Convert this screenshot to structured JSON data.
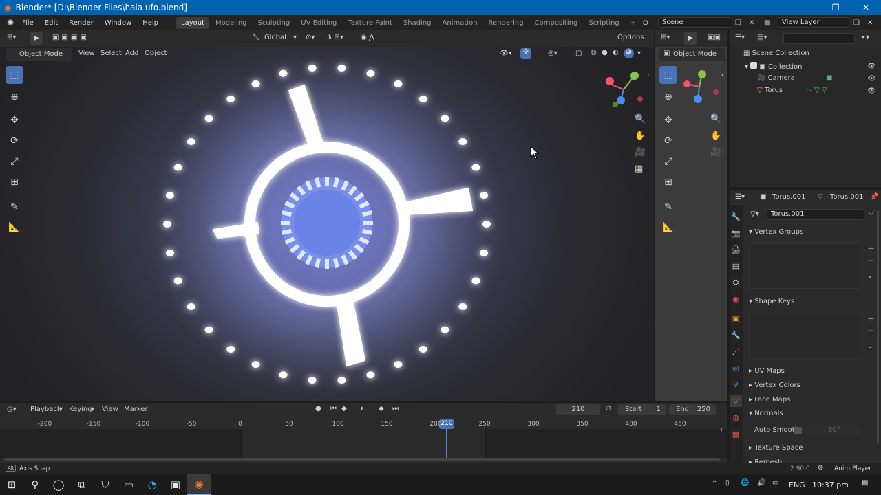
{
  "window": {
    "title": "Blender* [D:\\Blender Files\\hala ufo.blend]",
    "minimize": "—",
    "maximize": "❐",
    "close": "✕"
  },
  "menus": [
    "File",
    "Edit",
    "Render",
    "Window",
    "Help"
  ],
  "workspaces": [
    "Layout",
    "Modeling",
    "Sculpting",
    "UV Editing",
    "Texture Paint",
    "Shading",
    "Animation",
    "Rendering",
    "Compositing",
    "Scripting"
  ],
  "add_workspace": "+",
  "scene": {
    "name": "Scene",
    "view_layer": "View Layer"
  },
  "viewport": {
    "mode": "Object Mode",
    "menus": [
      "View",
      "Select",
      "Add",
      "Object"
    ],
    "orientation": "Global",
    "options": "Options"
  },
  "secondary_viewport": {
    "mode": "Object Mode"
  },
  "outliner": {
    "search_placeholder": "",
    "items": [
      {
        "label": "Scene Collection"
      },
      {
        "label": "Collection"
      },
      {
        "label": "Camera"
      },
      {
        "label": "Torus"
      }
    ]
  },
  "properties": {
    "object_name": "Torus.001",
    "mesh_name": "Torus.001",
    "data_field": "Torus.001",
    "sections": {
      "vertex_groups": "Vertex Groups",
      "shape_keys": "Shape Keys",
      "uv_maps": "UV Maps",
      "vertex_colors": "Vertex Colors",
      "face_maps": "Face Maps",
      "normals": "Normals",
      "auto_smooth": "Auto Smooth",
      "auto_smooth_angle": "30°",
      "texture_space": "Texture Space",
      "remesh": "Remesh"
    }
  },
  "timeline": {
    "menus": [
      "Playback",
      "Keying",
      "View",
      "Marker"
    ],
    "current_frame": "210",
    "start_label": "Start",
    "start": "1",
    "end_label": "End",
    "end": "250",
    "ticks": [
      "-200",
      "-150",
      "-100",
      "-50",
      "0",
      "50",
      "100",
      "150",
      "200",
      "250",
      "300",
      "350",
      "400",
      "450"
    ],
    "playhead_label": "210"
  },
  "statusbar": {
    "hint": "Axis Snap",
    "version": "2.90.0",
    "right_app": "Anim Player"
  },
  "taskbar": {
    "lang": "ENG",
    "time": "10:37 pm"
  }
}
